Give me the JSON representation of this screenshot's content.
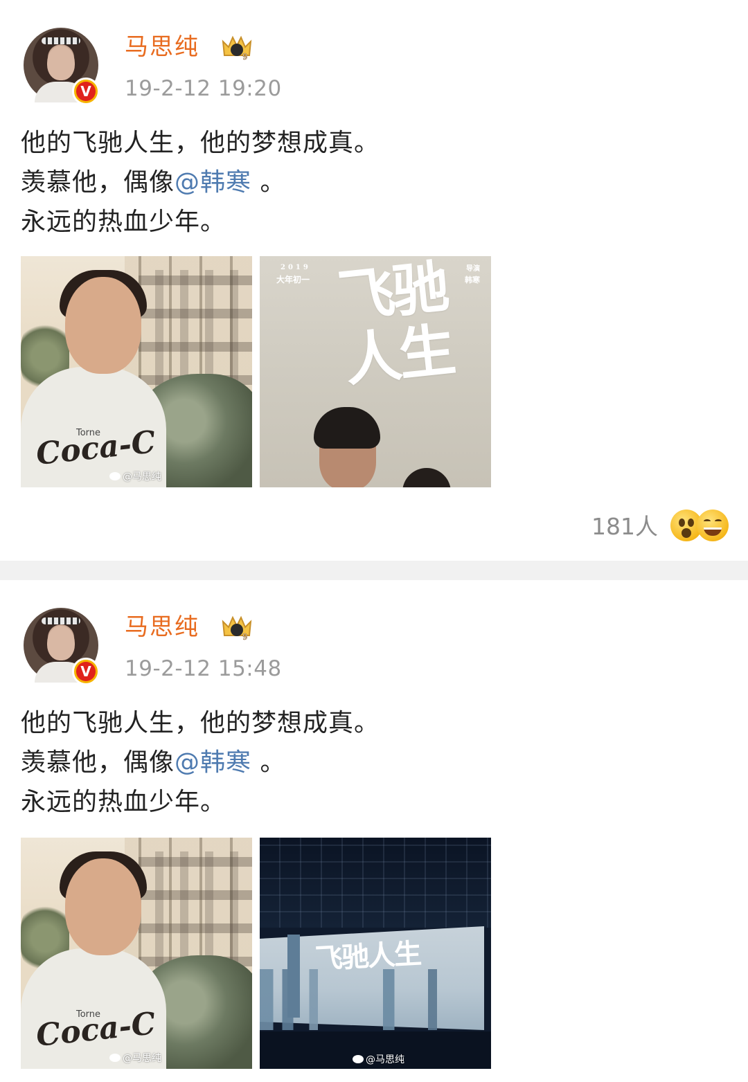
{
  "posts": [
    {
      "username": "马思纯",
      "timestamp": "19-2-12 19:20",
      "verified_badge": "V",
      "lines": [
        "他的飞驰人生，他的梦想成真。",
        "羡慕他，偶像",
        "永远的热血少年。"
      ],
      "mention": "@韩寒",
      "mention_suffix": " 。",
      "images": [
        {
          "watermark": "@马思纯"
        },
        {
          "poster_year": "2019",
          "poster_date": "大年初一",
          "poster_credit_1": "导演",
          "poster_credit_2": "韩寒",
          "poster_title": "飞驰人生"
        }
      ],
      "reactions": {
        "count_text": "181人",
        "icons": [
          "surprised-emoji",
          "laughing-emoji"
        ]
      }
    },
    {
      "username": "马思纯",
      "timestamp": "19-2-12 15:48",
      "verified_badge": "V",
      "lines": [
        "他的飞驰人生，他的梦想成真。",
        "羡慕他，偶像",
        "永远的热血少年。"
      ],
      "mention": "@韩寒",
      "mention_suffix": " 。",
      "images": [
        {
          "watermark": "@马思纯"
        },
        {
          "screen_title": "飞驰人生",
          "watermark": "@马思纯"
        }
      ]
    }
  ],
  "colors": {
    "username": "#e86b1f",
    "mention": "#4f7bb0",
    "timestamp": "#9b9b9b",
    "divider": "#f1f1f1"
  }
}
